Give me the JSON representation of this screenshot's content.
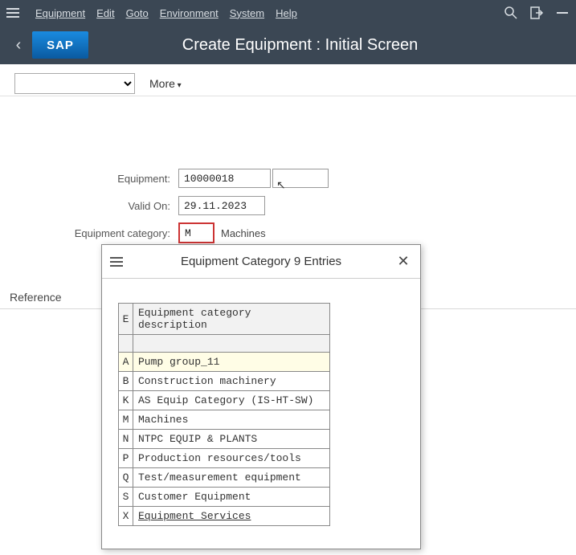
{
  "menu": {
    "items": [
      "Equipment",
      "Edit",
      "Goto",
      "Environment",
      "System",
      "Help"
    ]
  },
  "header": {
    "logo_text": "SAP",
    "title": "Create Equipment : Initial Screen"
  },
  "toolbar": {
    "more_label": "More"
  },
  "form": {
    "equipment_label": "Equipment",
    "equipment_value": "10000018",
    "valid_on_label": "Valid On",
    "valid_on_value": "29.11.2023",
    "category_label": "Equipment category",
    "category_value": "M",
    "category_desc": "Machines"
  },
  "reference_header": "Reference",
  "popup": {
    "title": "Equipment Category 9 Entries",
    "col_code": "E",
    "col_desc": "Equipment category description",
    "rows": [
      {
        "code": "A",
        "desc": "Pump group_11"
      },
      {
        "code": "B",
        "desc": "Construction machinery"
      },
      {
        "code": "K",
        "desc": "AS Equip Category (IS-HT-SW)"
      },
      {
        "code": "M",
        "desc": "Machines"
      },
      {
        "code": "N",
        "desc": "NTPC EQUIP & PLANTS"
      },
      {
        "code": "P",
        "desc": "Production resources/tools"
      },
      {
        "code": "Q",
        "desc": "Test/measurement equipment"
      },
      {
        "code": "S",
        "desc": "Customer Equipment"
      },
      {
        "code": "X",
        "desc": "Equipment Services"
      }
    ]
  }
}
